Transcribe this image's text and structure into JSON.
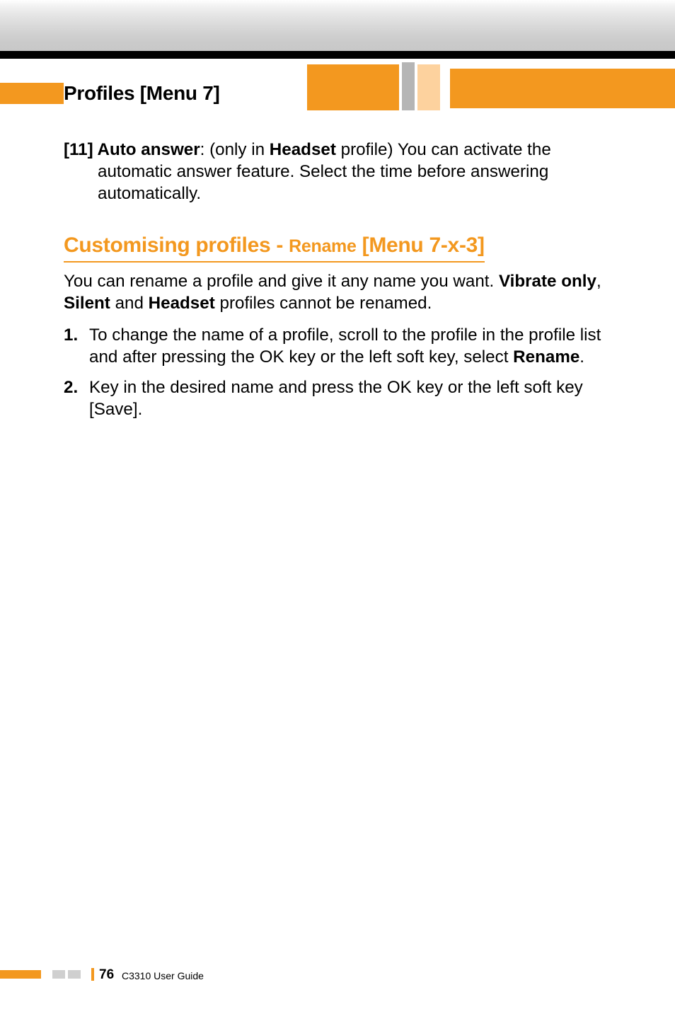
{
  "header": {
    "section_title": "Profiles [Menu 7]"
  },
  "item11": {
    "prefix": "[11] Auto answer",
    "colon_text": ": (only in ",
    "headset_word": "Headset",
    "after_headset": " profile) You can activate the automatic answer feature. Select the time before answering automatically."
  },
  "h2": {
    "part1": "Customising profiles - ",
    "rename": "Rename",
    "part2": " [Menu 7-x-3]"
  },
  "rename_intro": {
    "t1": "You can rename a profile and give it any name you want. ",
    "vibrate": "Vibrate only",
    "t2": ", ",
    "silent": "Silent",
    "t3": " and ",
    "headset": "Headset",
    "t4": " profiles cannot be renamed."
  },
  "steps": {
    "s1_num": "1.",
    "s1_a": "To change the name of a profile, scroll to the profile in the profile list and after pressing the OK key or the left soft key, select ",
    "s1_rename": "Rename",
    "s1_dot": ".",
    "s2_num": "2.",
    "s2_text": "Key in the desired name and press the OK key or the left soft key [Save]."
  },
  "footer": {
    "page": "76",
    "label": "C3310 User Guide"
  }
}
